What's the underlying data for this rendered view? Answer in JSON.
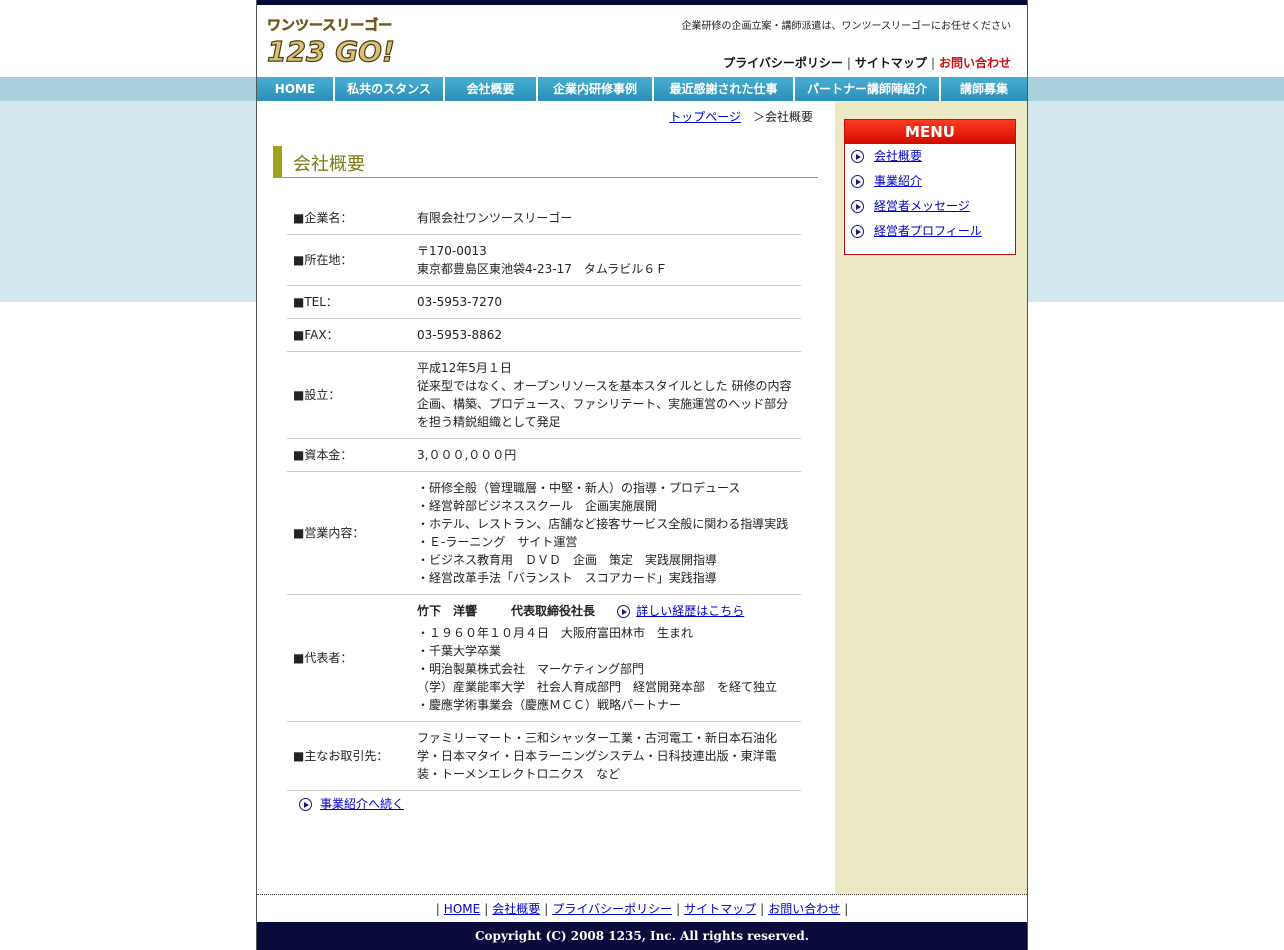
{
  "header": {
    "logo_kana": "ワンツースリーゴー",
    "logo_text": "123 GO!",
    "tagline": "企業研修の企画立案・講師派遣は、ワンツースリーゴーにお任せください",
    "links": {
      "privacy": "プライバシーポリシー",
      "sitemap": "サイトマップ",
      "contact": "お問い合わせ",
      "sep": "|"
    }
  },
  "nav": {
    "items": [
      {
        "label": "HOME"
      },
      {
        "label": "私共のスタンス"
      },
      {
        "label": "会社概要"
      },
      {
        "label": "企業内研修事例"
      },
      {
        "label": "最近感謝された仕事"
      },
      {
        "label": "パートナー講師陣紹介"
      },
      {
        "label": "講師募集"
      }
    ]
  },
  "breadcrumb": {
    "top": "トップページ",
    "current": "＞会社概要"
  },
  "main": {
    "title": "会社概要",
    "rows": [
      {
        "label": "■企業名：",
        "value": "有限会社ワンツースリーゴー"
      },
      {
        "label": "■所在地：",
        "line1": "〒170-0013",
        "line2": "東京都豊島区東池袋4-23-17　タムラビル６Ｆ"
      },
      {
        "label": "■TEL：",
        "value": "03-5953-7270"
      },
      {
        "label": "■FAX：",
        "value": "03-5953-8862"
      },
      {
        "label": "■設立：",
        "line1": "平成12年5月１日",
        "line2": "従来型ではなく、オープンリソースを基本スタイルとした 研修の内容",
        "line3": "企画、構築、プロデュース、ファシリテート、実施運営のヘッド部分",
        "line4": "を担う精鋭組織として発足"
      },
      {
        "label": "■資本金：",
        "value": "3,０００,０００円"
      },
      {
        "label": "■営業内容：",
        "line1": "・研修全般（管理職層・中堅・新人）の指導・プロデュース",
        "line2": "・経営幹部ビジネススクール　企画実施展開",
        "line3": "・ホテル、レストラン、店舗など接客サービス全般に関わる指導実践",
        "line4": "・Ｅ-ラーニング　サイト運営",
        "line5": "・ビジネス教育用　ＤＶＤ　企画　策定　実践展開指導",
        "line6": "・経営改革手法「バランスト　スコアカード」実践指導"
      },
      {
        "label": "■代表者：",
        "name": "竹下　洋響",
        "title": "代表取締役社長",
        "link": "詳しい経歴はこちら",
        "line1": "・１９６０年１０月４日　大阪府富田林市　生まれ",
        "line2": "・千葉大学卒業",
        "line3": "・明治製菓株式会社　マーケティング部門",
        "line4": "（学）産業能率大学　社会人育成部門　経営開発本部　を経て独立",
        "line5": "・慶應学術事業会（慶應ＭＣＣ）戦略パートナー"
      },
      {
        "label": "■主なお取引先：",
        "line1": "ファミリーマート・三和シャッター工業・古河電工・新日本石油化",
        "line2": "学・日本マタイ・日本ラーニングシステム・日科技連出版・東洋電",
        "line3": "装・トーメンエレクトロニクス　など"
      }
    ],
    "next_link": "事業紹介へ続く"
  },
  "sidebar": {
    "menu_title": "MENU",
    "items": [
      {
        "label": "会社概要"
      },
      {
        "label": "事業紹介"
      },
      {
        "label": "経営者メッセージ"
      },
      {
        "label": "経営者プロフィール"
      }
    ]
  },
  "footer": {
    "links": {
      "home": "HOME",
      "company": "会社概要",
      "privacy": "プライバシーポリシー",
      "sitemap": "サイトマップ",
      "contact": "お問い合わせ",
      "sep": "|"
    },
    "copyright": "Copyright (C) 2008 1235, Inc. All rights reserved."
  },
  "colors": {
    "nav_blue": "#2b8fb7",
    "title_olive": "#a0a21c",
    "sidebar_bg": "#ede9c4",
    "menu_red": "#d00a00",
    "footer_navy": "#0b0b3b",
    "link_blue": "#0000cc"
  }
}
